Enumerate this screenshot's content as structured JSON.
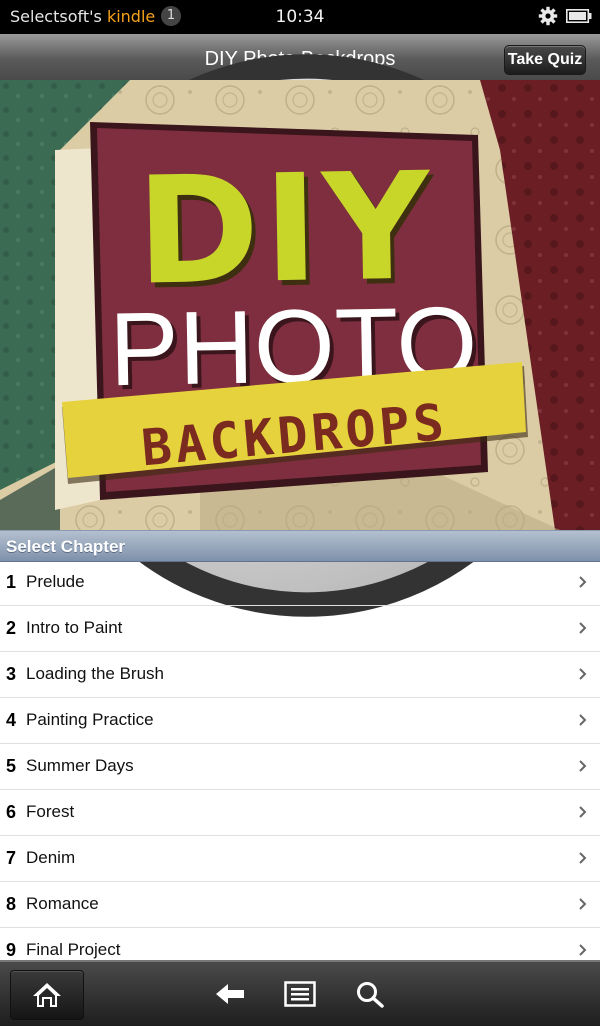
{
  "status_bar": {
    "owner_name": "Selectsoft's",
    "brand": "kindle",
    "notification_count": "1",
    "time": "10:34",
    "icons": [
      "gear-icon",
      "battery-icon"
    ]
  },
  "title_bar": {
    "title": "DIY Photo Backdrops",
    "info_icon": "info-icon",
    "quiz_label": "Take Quiz"
  },
  "cover": {
    "line1": "DIY",
    "line2": "PHOTO",
    "line3": "BACKDROPS",
    "colors": {
      "maroon": "#7e2e3e",
      "lime": "#c8d62a",
      "yellow": "#e5d23c",
      "teal": "#3b6b52",
      "cream": "#e7dcbc"
    }
  },
  "chapter_section": {
    "header": "Select Chapter",
    "items": [
      {
        "num": "1",
        "label": "Prelude"
      },
      {
        "num": "2",
        "label": "Intro to Paint"
      },
      {
        "num": "3",
        "label": "Loading the Brush"
      },
      {
        "num": "4",
        "label": "Painting Practice"
      },
      {
        "num": "5",
        "label": "Summer Days"
      },
      {
        "num": "6",
        "label": "Forest"
      },
      {
        "num": "7",
        "label": "Denim"
      },
      {
        "num": "8",
        "label": "Romance"
      },
      {
        "num": "9",
        "label": "Final Project"
      }
    ]
  },
  "nav_bar": {
    "icons": [
      "home-icon",
      "back-arrow-icon",
      "menu-icon",
      "search-icon"
    ]
  }
}
